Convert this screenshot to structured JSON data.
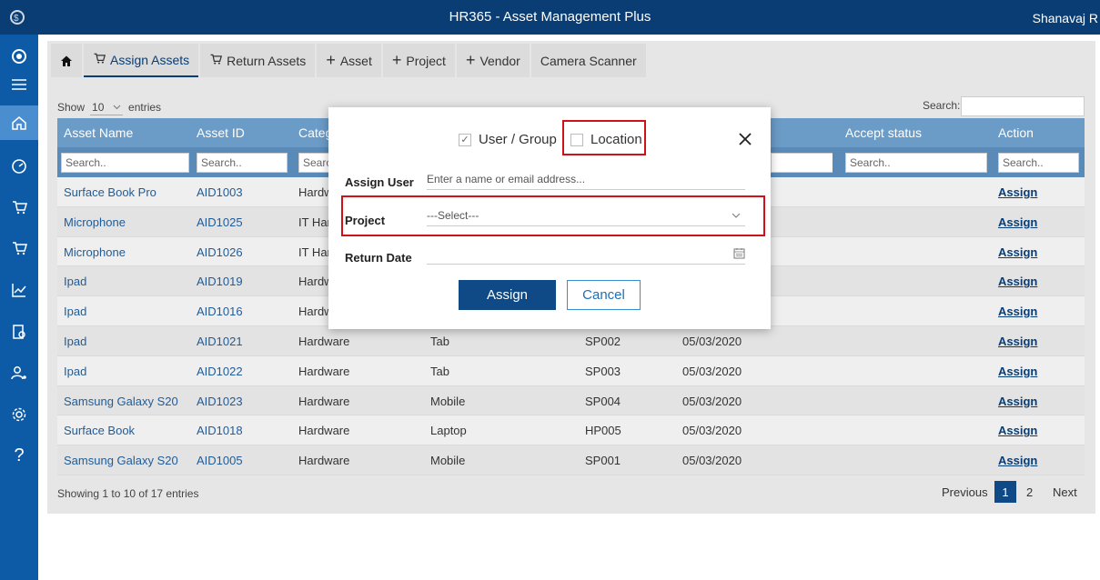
{
  "app": {
    "title": "HR365 - Asset Management Plus",
    "user": "Shanavaj R"
  },
  "toolbar": [
    {
      "label": "Assign Assets",
      "icon": "cart-icon"
    },
    {
      "label": "Return Assets",
      "icon": "cart-icon"
    },
    {
      "label": "Asset",
      "icon": "plus-icon"
    },
    {
      "label": "Project",
      "icon": "plus-icon"
    },
    {
      "label": "Vendor",
      "icon": "plus-icon"
    },
    {
      "label": "Camera Scanner",
      "icon": ""
    }
  ],
  "list": {
    "show_label": "Show",
    "entries_value": "10",
    "entries_label": "entries",
    "search_label": "Search:",
    "columns": [
      "Asset Name",
      "Asset ID",
      "Categ",
      "Accept status",
      "Action"
    ],
    "filter_placeholder": "Search..",
    "rows": [
      {
        "name": "Surface Book Pro",
        "id": "AID1003",
        "category": "Hardw",
        "type": "",
        "code": "",
        "date": "",
        "action": "Assign"
      },
      {
        "name": "Microphone",
        "id": "AID1025",
        "category": "IT Hard",
        "type": "",
        "code": "",
        "date": "",
        "action": "Assign"
      },
      {
        "name": "Microphone",
        "id": "AID1026",
        "category": "IT Hard",
        "type": "",
        "code": "",
        "date": "",
        "action": "Assign"
      },
      {
        "name": "Ipad",
        "id": "AID1019",
        "category": "Hardw",
        "type": "",
        "code": "",
        "date": "",
        "action": "Assign"
      },
      {
        "name": "Ipad",
        "id": "AID1016",
        "category": "Hardw",
        "type": "",
        "code": "",
        "date": "",
        "action": "Assign"
      },
      {
        "name": "Ipad",
        "id": "AID1021",
        "category": "Hardware",
        "type": "Tab",
        "code": "SP002",
        "date": "05/03/2020",
        "action": "Assign"
      },
      {
        "name": "Ipad",
        "id": "AID1022",
        "category": "Hardware",
        "type": "Tab",
        "code": "SP003",
        "date": "05/03/2020",
        "action": "Assign"
      },
      {
        "name": "Samsung Galaxy S20",
        "id": "AID1023",
        "category": "Hardware",
        "type": "Mobile",
        "code": "SP004",
        "date": "05/03/2020",
        "action": "Assign"
      },
      {
        "name": "Surface Book",
        "id": "AID1018",
        "category": "Hardware",
        "type": "Laptop",
        "code": "HP005",
        "date": "05/03/2020",
        "action": "Assign"
      },
      {
        "name": "Samsung Galaxy S20",
        "id": "AID1005",
        "category": "Hardware",
        "type": "Mobile",
        "code": "SP001",
        "date": "05/03/2020",
        "action": "Assign"
      }
    ],
    "info": "Showing 1 to 10 of 17 entries",
    "pager": {
      "previous": "Previous",
      "page1": "1",
      "page2": "2",
      "next": "Next"
    }
  },
  "modal": {
    "option_user_group": "User / Group",
    "option_location": "Location",
    "assign_user_label": "Assign User",
    "assign_user_placeholder": "Enter a name or email address...",
    "project_label": "Project",
    "project_value": "---Select---",
    "return_date_label": "Return Date",
    "assign_button": "Assign",
    "cancel_button": "Cancel",
    "highlight_color": "#d0111a"
  }
}
